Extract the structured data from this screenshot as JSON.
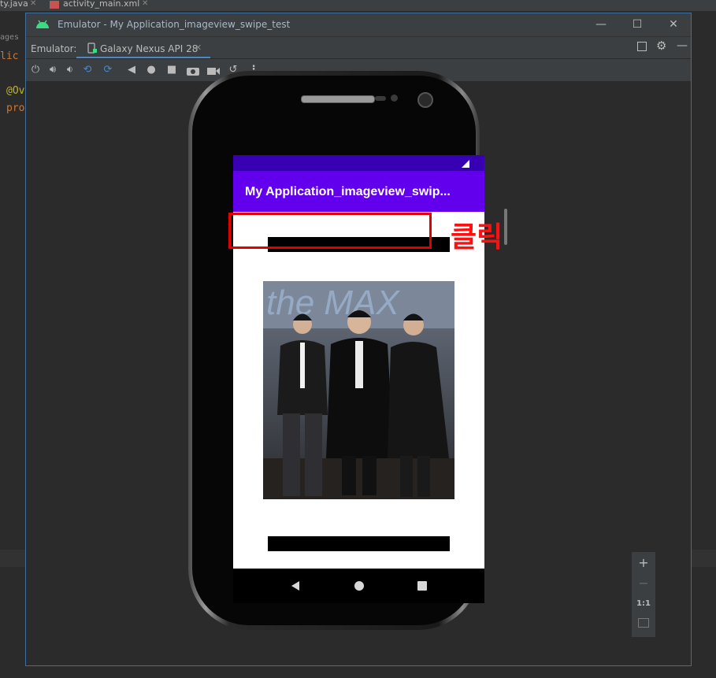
{
  "ide": {
    "tabs": [
      {
        "label": "ty.java",
        "icon": "java-file-icon"
      },
      {
        "label": "activity_main.xml",
        "icon": "xml-file-icon"
      }
    ],
    "gutter_text": [
      "ages",
      "lic",
      "@Ov",
      "pro"
    ]
  },
  "emulator_window": {
    "title": "Emulator - My Application_imageview_swipe_test",
    "tab_label": "Emulator:",
    "device_tab": "Galaxy Nexus API 28",
    "toolbar_icons": [
      "power-icon",
      "volume-up-icon",
      "volume-down-icon",
      "rotate-left-icon",
      "rotate-right-icon",
      "back-icon",
      "home-icon",
      "overview-icon",
      "camera-icon",
      "video-icon",
      "snapshot-icon",
      "more-icon"
    ]
  },
  "app": {
    "title": "My Application_imageview_swip...",
    "colors": {
      "status_bar": "#3700b3",
      "app_bar": "#6200ee"
    }
  },
  "photo": {
    "banner_text": "the MAX"
  },
  "annotation": {
    "text": "클릭",
    "color": "#ff1010"
  },
  "zoom_controls": {
    "ratio_label": "1:1"
  }
}
